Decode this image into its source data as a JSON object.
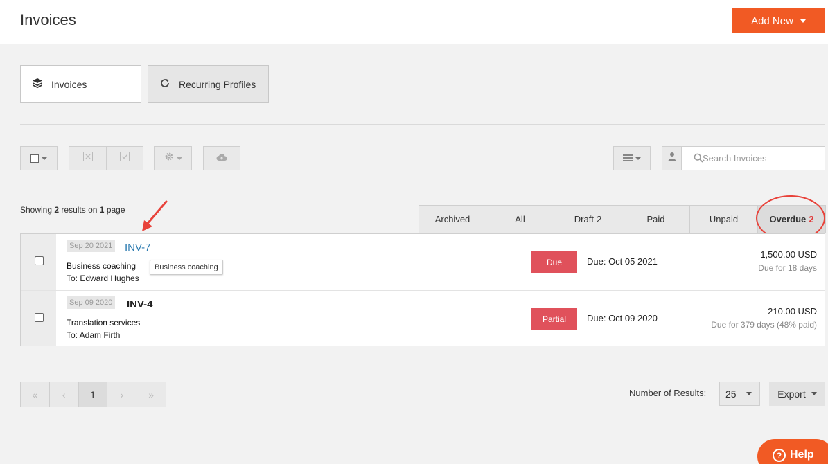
{
  "header": {
    "title": "Invoices",
    "add_new": "Add New"
  },
  "view_tabs": [
    {
      "label": "Invoices",
      "icon": "layers-icon",
      "active": true
    },
    {
      "label": "Recurring Profiles",
      "icon": "refresh-icon",
      "active": false
    }
  ],
  "toolbar": {
    "icons": [
      "checkbox-dropdown-icon",
      "void-icon",
      "approve-icon",
      "gear-dropdown-icon",
      "cloud-upload-icon",
      "list-view-icon"
    ]
  },
  "search": {
    "icon": "user-icon",
    "placeholder": "Search Invoices"
  },
  "results": {
    "prefix": "Showing",
    "count": "2",
    "middle": "results on",
    "pages": "1",
    "suffix": "page"
  },
  "filters": [
    {
      "label": "Archived",
      "count": ""
    },
    {
      "label": "All",
      "count": ""
    },
    {
      "label": "Draft",
      "count": "2"
    },
    {
      "label": "Paid",
      "count": ""
    },
    {
      "label": "Unpaid",
      "count": ""
    },
    {
      "label": "Overdue",
      "count": "2",
      "active": true
    }
  ],
  "invoices": [
    {
      "date": "Sep 20 2021",
      "number": "INV-7",
      "description": "Business coaching",
      "to": "To: Edward Hughes",
      "tooltip": "Business coaching",
      "status": "Due",
      "due_date": "Due: Oct 05 2021",
      "amount": "1,500.00 USD",
      "due_for": "Due for 18 days"
    },
    {
      "date": "Sep 09 2020",
      "number": "INV-4",
      "description": "Translation services",
      "to": "To: Adam Firth",
      "status": "Partial",
      "due_date": "Due: Oct 09 2020",
      "amount": "210.00 USD",
      "due_for": "Due for 379 days (48% paid)"
    }
  ],
  "pagination": {
    "first": "«",
    "prev": "‹",
    "current": "1",
    "next": "›",
    "last": "»"
  },
  "footer": {
    "num_results_label": "Number of Results:",
    "num_results": "25",
    "export": "Export"
  },
  "help": {
    "label": "Help",
    "icon": "?"
  },
  "colors": {
    "accent": "#f15a24",
    "status_red": "#e0515b",
    "link": "#2a7ab0",
    "annotation": "#e8423a"
  }
}
